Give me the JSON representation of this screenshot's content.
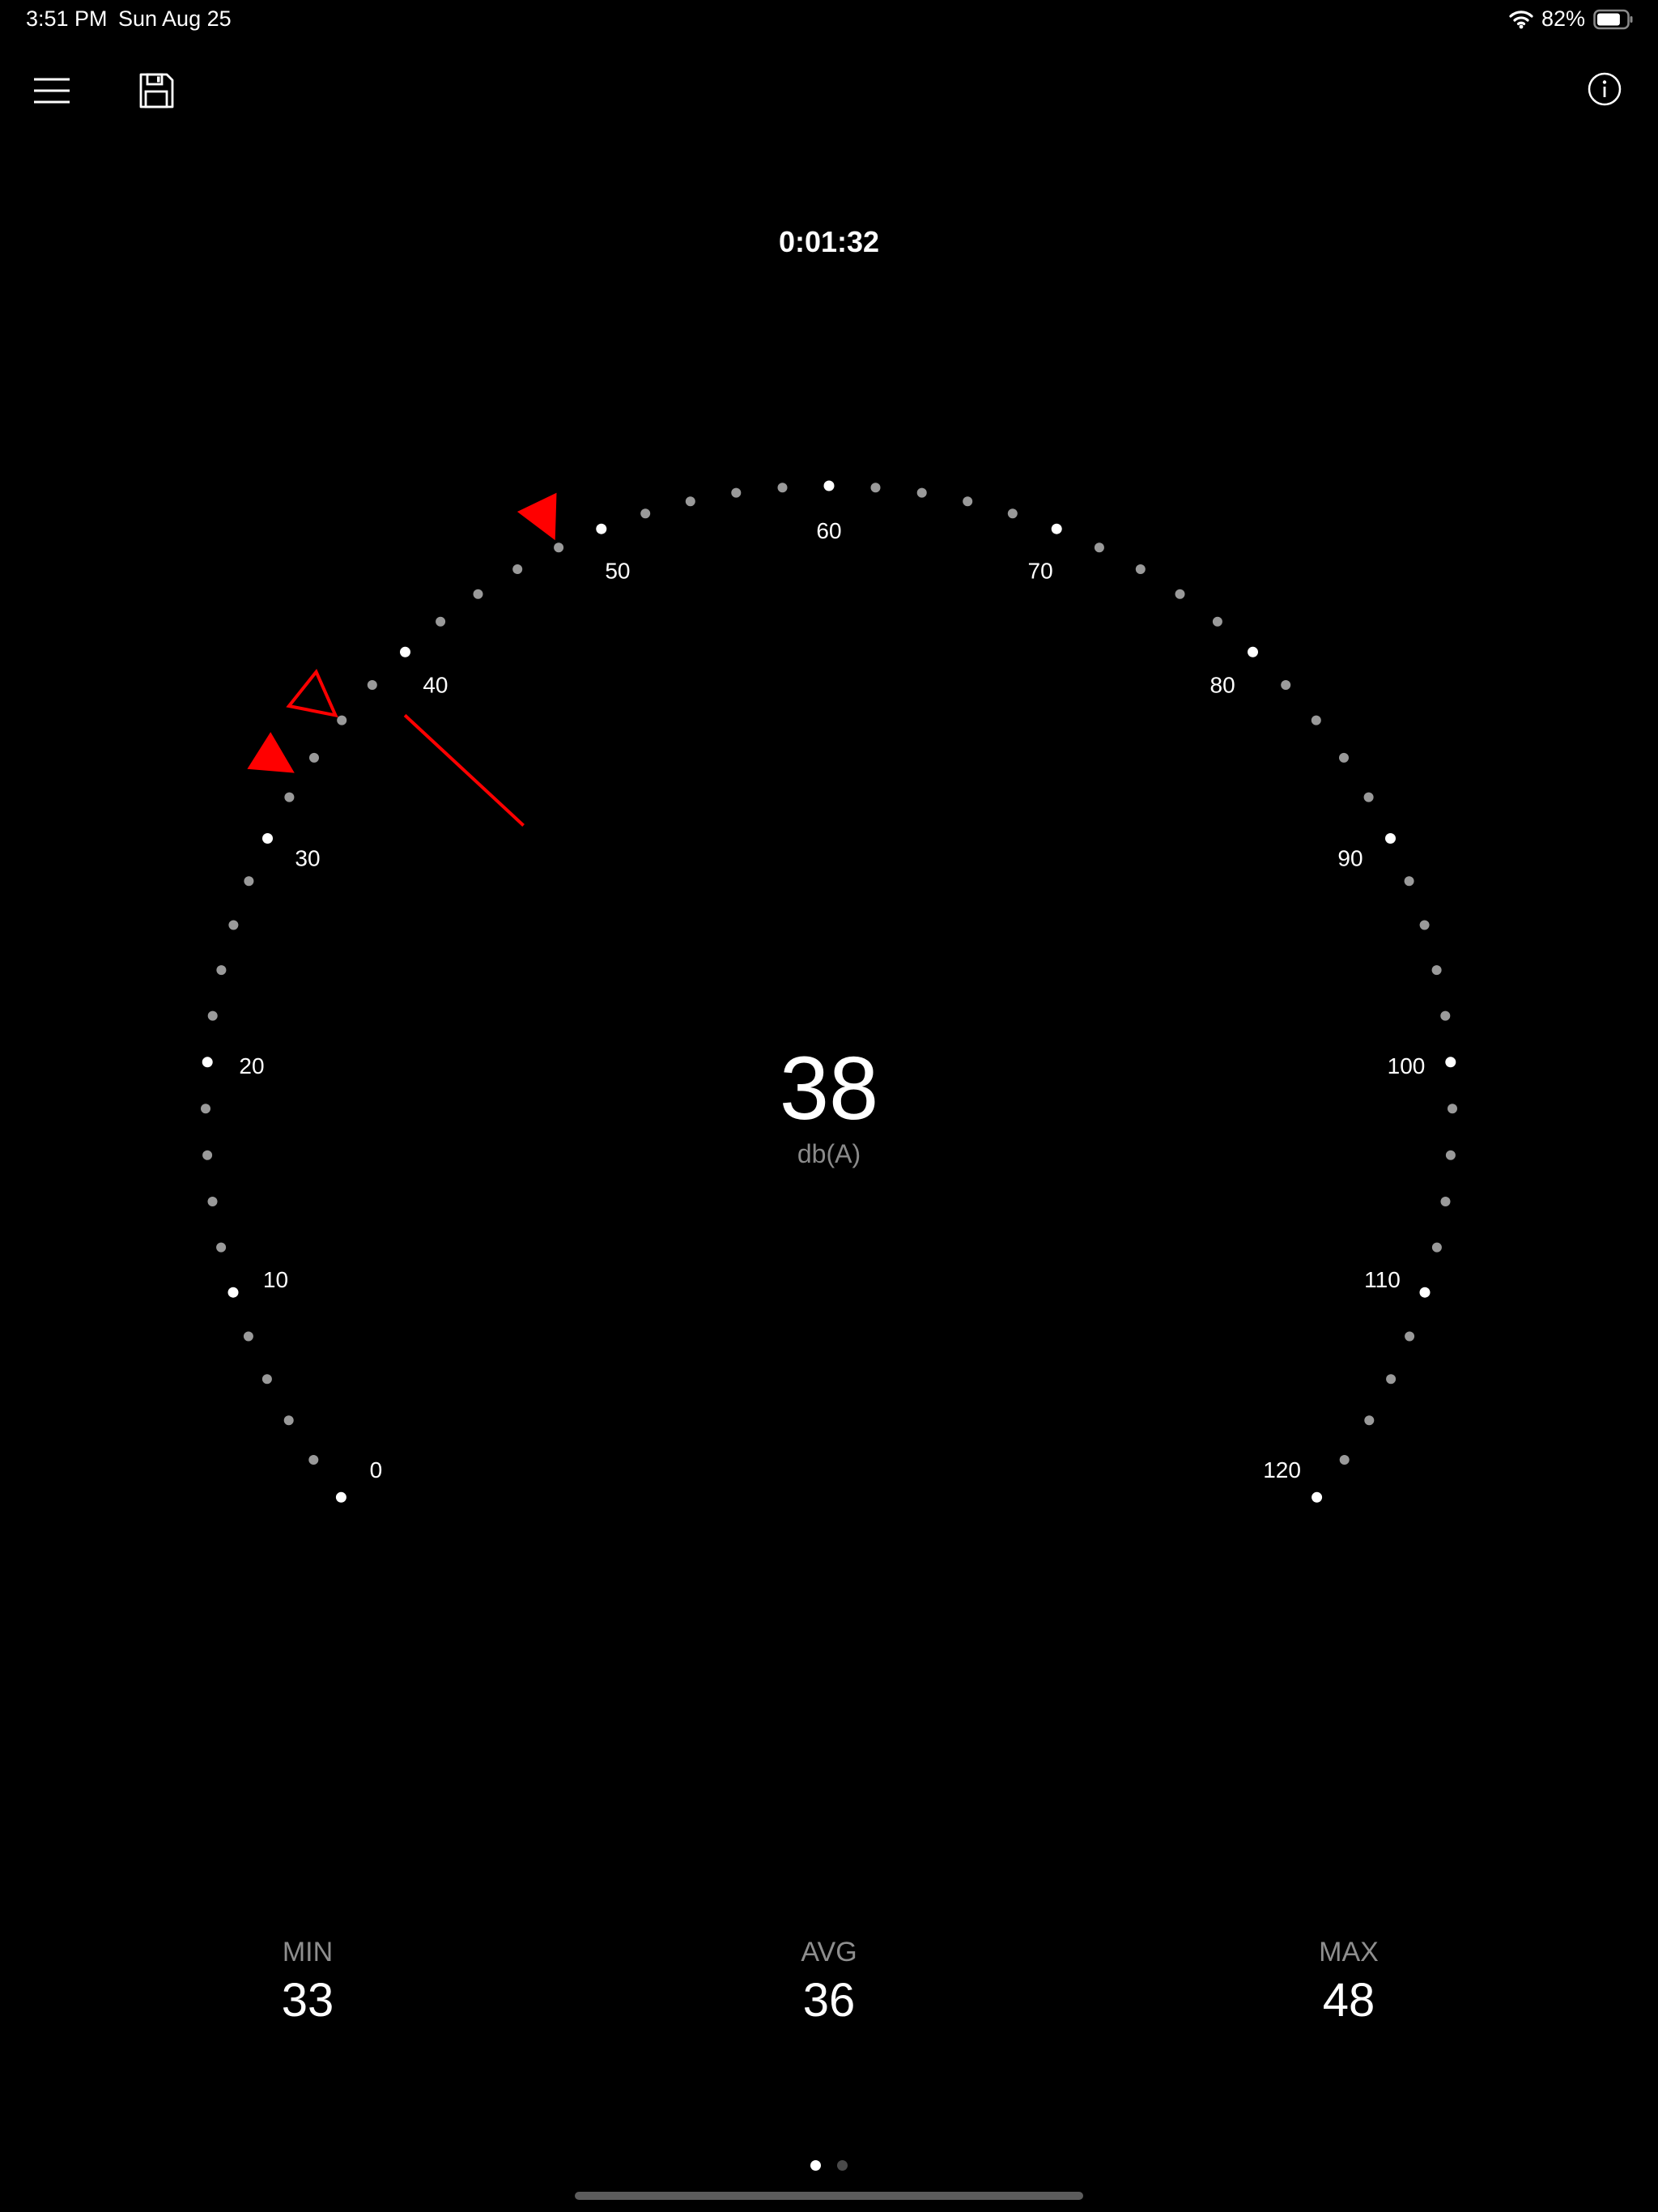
{
  "status_bar": {
    "time": "3:51 PM",
    "date": "Sun Aug 25",
    "battery_percent": "82%",
    "battery_level": 0.82
  },
  "toolbar": {
    "menu_icon": "hamburger-menu-icon",
    "save_icon": "floppy-disk-icon",
    "info_icon": "info-circle-icon"
  },
  "timer": "0:01:32",
  "meter": {
    "scale_min": 0,
    "scale_max": 120,
    "major_step": 10,
    "minor_step": 2,
    "tick_labels": [
      "0",
      "10",
      "20",
      "30",
      "40",
      "50",
      "60",
      "70",
      "80",
      "90",
      "100",
      "110",
      "120"
    ],
    "current_value": 38,
    "min_marker": 33,
    "avg_marker": 36,
    "max_marker": 48,
    "accent_color": "#ff0000",
    "major_dot_color": "#ffffff",
    "minor_dot_color": "#9a9a9a"
  },
  "reading": {
    "value": "38",
    "unit": "db(A)"
  },
  "stats": {
    "min": {
      "label": "MIN",
      "value": "33"
    },
    "avg": {
      "label": "AVG",
      "value": "36"
    },
    "max": {
      "label": "MAX",
      "value": "48"
    }
  },
  "pager": {
    "page_count": 2,
    "active_index": 0
  }
}
